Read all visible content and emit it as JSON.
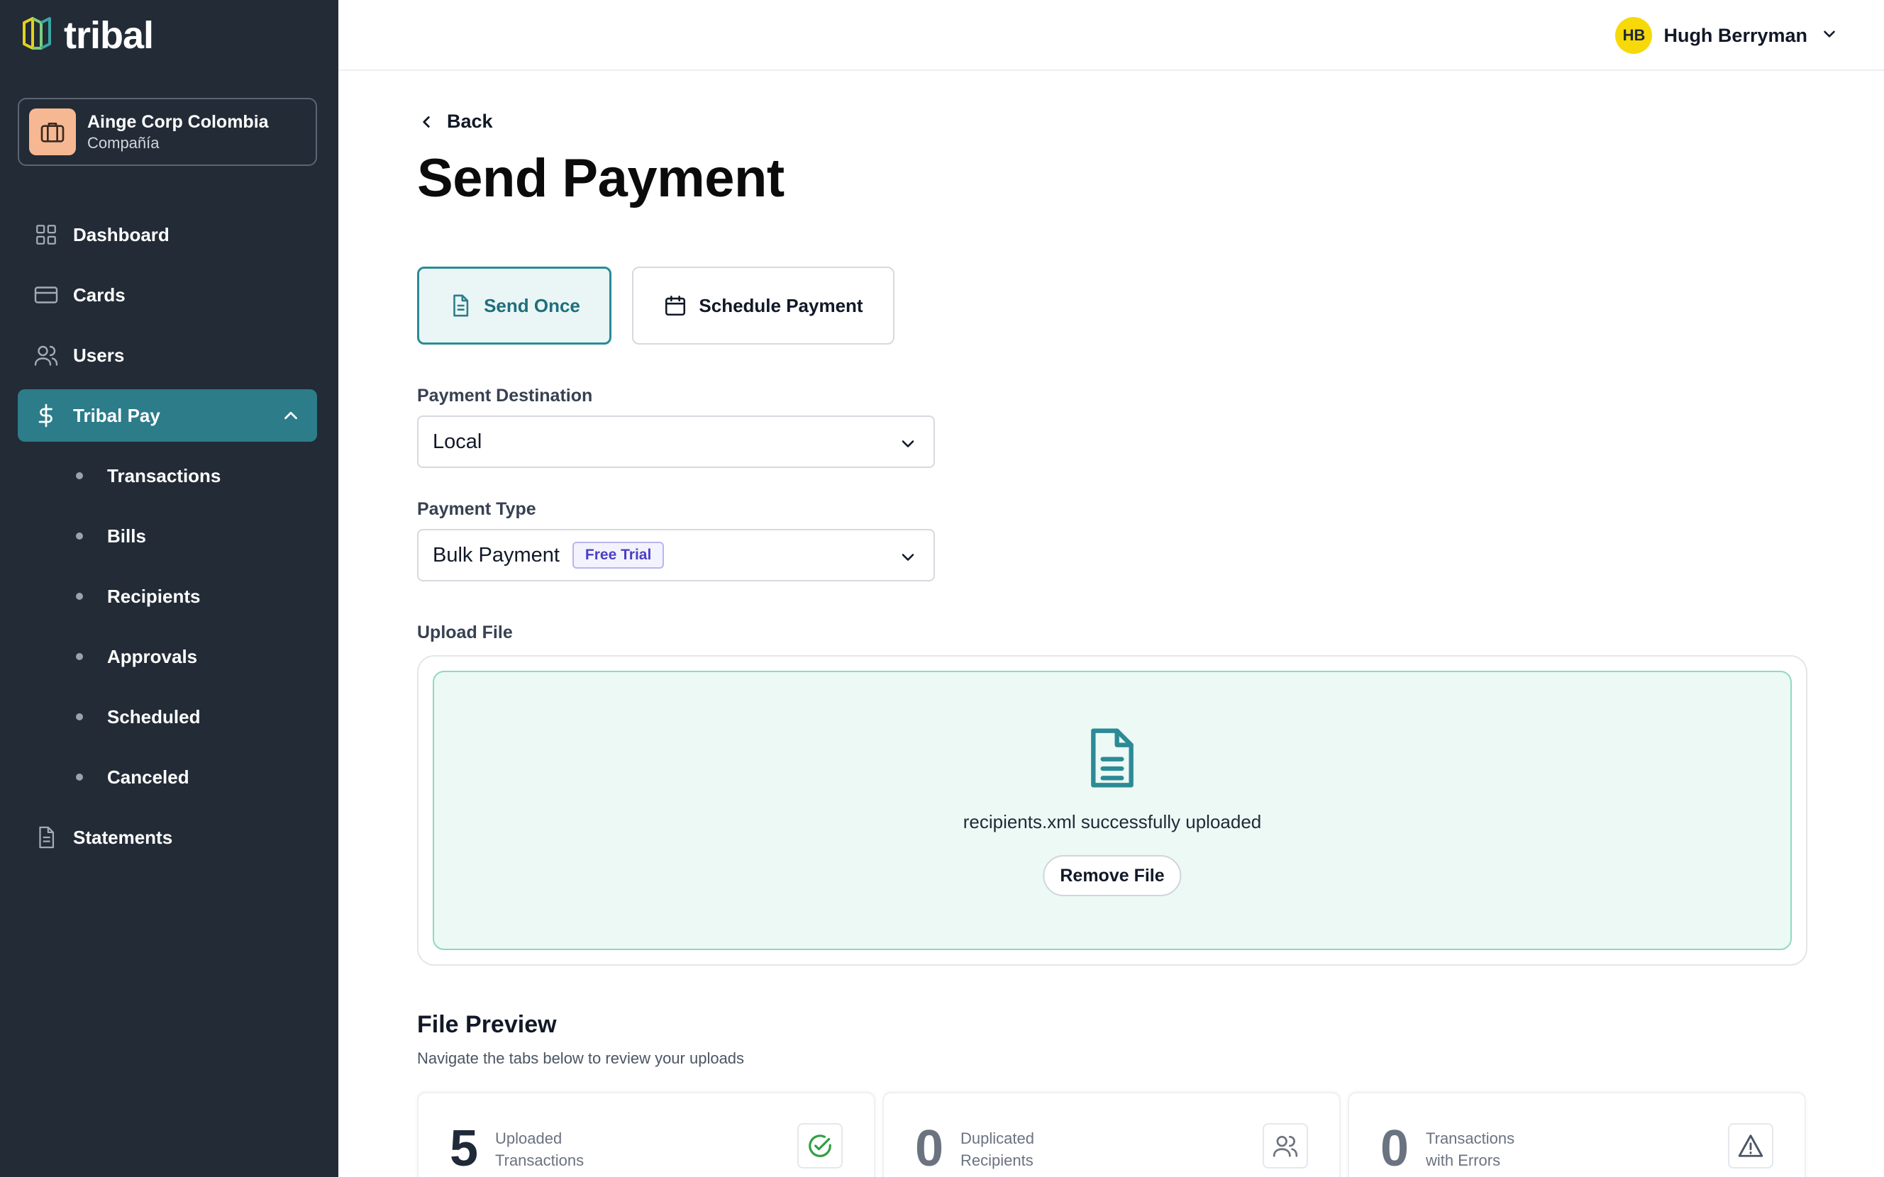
{
  "brand": {
    "name": "tribal"
  },
  "company": {
    "name": "Ainge Corp Colombia",
    "type": "Compañía"
  },
  "sidebar": {
    "items": [
      {
        "label": "Dashboard",
        "icon": "grid-icon"
      },
      {
        "label": "Cards",
        "icon": "card-icon"
      },
      {
        "label": "Users",
        "icon": "users-icon"
      },
      {
        "label": "Tribal Pay",
        "icon": "dollar-icon",
        "active": true,
        "expanded": true
      },
      {
        "label": "Statements",
        "icon": "document-icon"
      }
    ],
    "subitems": [
      "Transactions",
      "Bills",
      "Recipients",
      "Approvals",
      "Scheduled",
      "Canceled"
    ]
  },
  "user": {
    "initials": "HB",
    "name": "Hugh Berryman"
  },
  "page": {
    "back": "Back",
    "title": "Send Payment"
  },
  "modes": {
    "once": "Send Once",
    "schedule": "Schedule Payment",
    "selected": "once"
  },
  "destination": {
    "label": "Payment Destination",
    "value": "Local"
  },
  "payment_type": {
    "label": "Payment Type",
    "value": "Bulk Payment",
    "badge": "Free Trial"
  },
  "upload": {
    "label": "Upload File",
    "message": "recipients.xml successfully uploaded",
    "remove": "Remove File"
  },
  "preview": {
    "title": "File Preview",
    "subtitle": "Navigate the tabs below to review your uploads",
    "stats": [
      {
        "value": "5",
        "label_line1": "Uploaded",
        "label_line2": "Transactions",
        "icon": "check-circle-icon"
      },
      {
        "value": "0",
        "label_line1": "Duplicated",
        "label_line2": "Recipients",
        "icon": "users-icon"
      },
      {
        "value": "0",
        "label_line1": "Transactions",
        "label_line2": "with Errors",
        "icon": "warning-icon"
      }
    ]
  },
  "colors": {
    "sidebar_bg": "#222b36",
    "accent": "#2c7c8a",
    "avatar": "#f7d90a",
    "upload_bg": "#ecf9f5",
    "badge_text": "#4b40c4"
  }
}
